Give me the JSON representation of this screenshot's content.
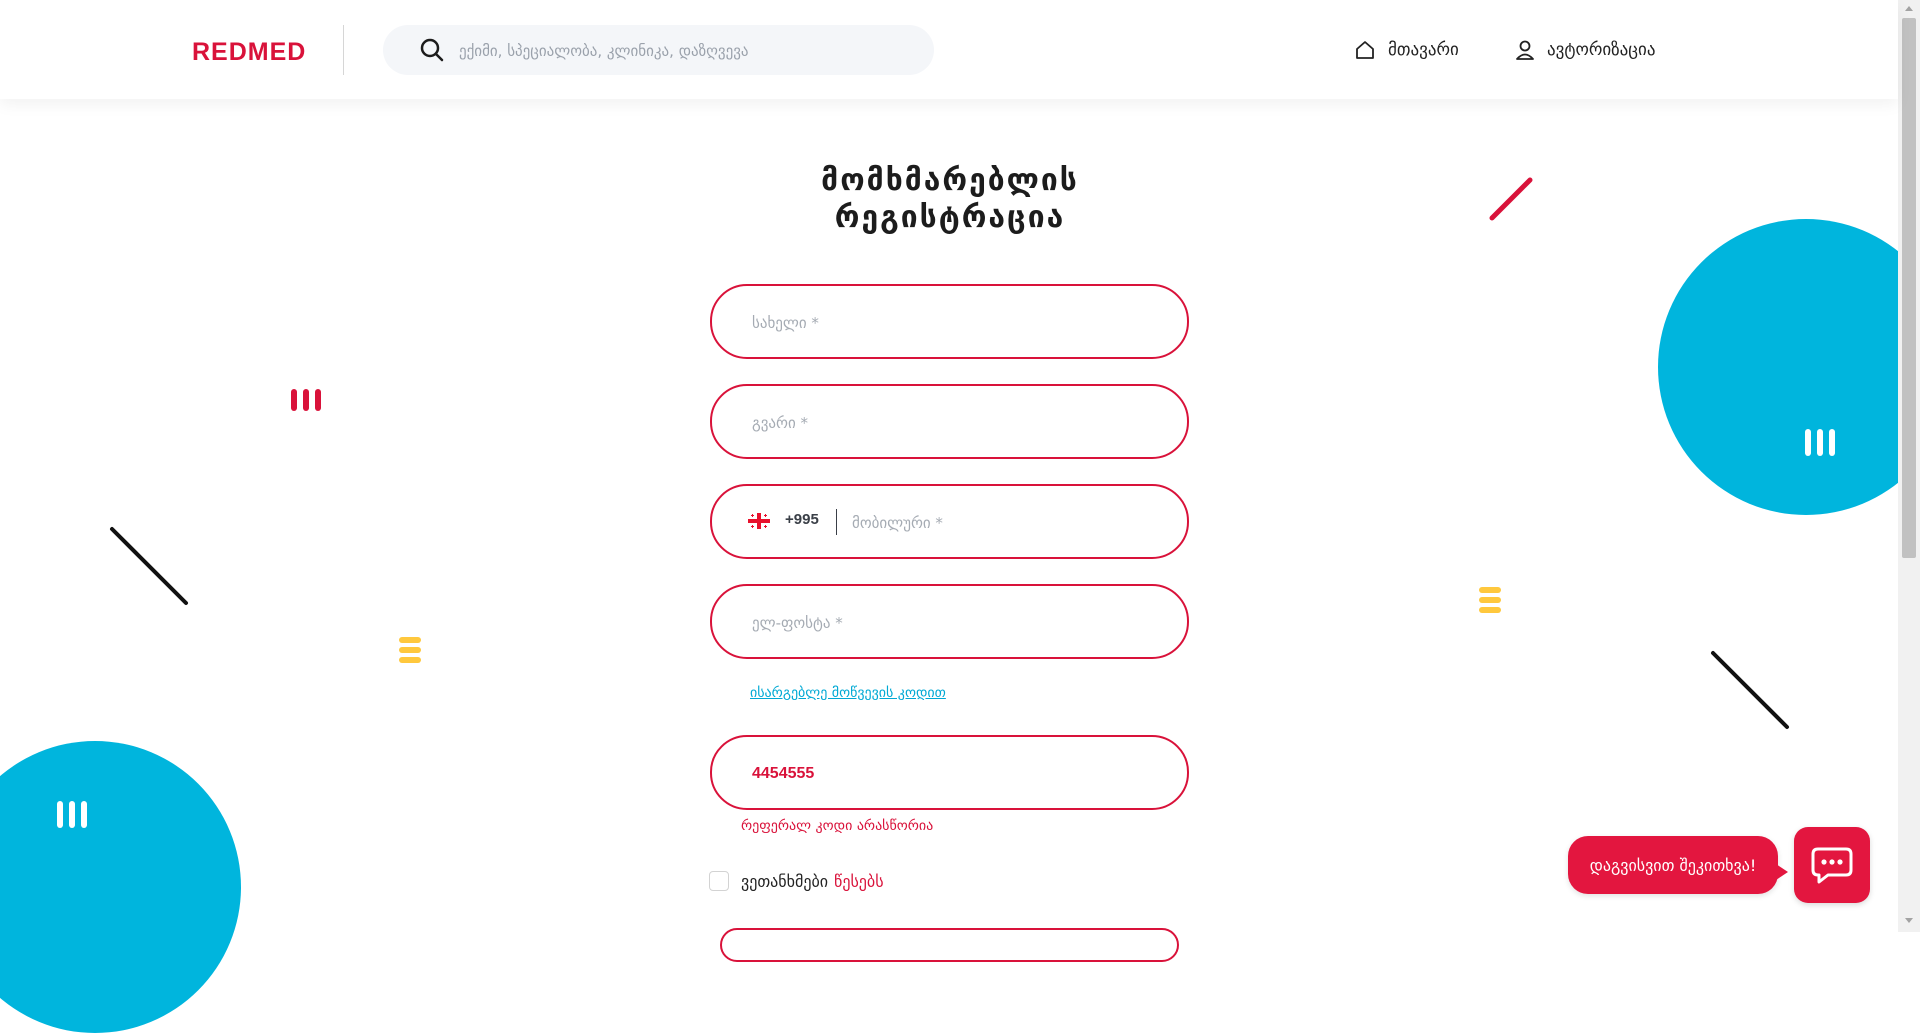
{
  "header": {
    "logo_text": "REDMED",
    "search": {
      "placeholder": "ექიმი, სპეციალობა, კლინიკა, დაზღვევა",
      "icon": "search-icon"
    },
    "nav": [
      {
        "label": "მთავარი",
        "icon": "home-icon"
      },
      {
        "label": "ავტორიზაცია",
        "icon": "user-icon"
      }
    ]
  },
  "form": {
    "title_line1": "მომხმარებლის",
    "title_line2": "რეგისტრაცია",
    "first_name": {
      "placeholder": "სახელი *",
      "value": ""
    },
    "last_name": {
      "placeholder": "გვარი *",
      "value": ""
    },
    "phone": {
      "country_code": "+995",
      "flag_icon": "georgia-flag-icon",
      "placeholder": "მობილური *",
      "value": ""
    },
    "email": {
      "placeholder": "ელ-ფოსტა *",
      "value": ""
    },
    "referral_link_label": "ისარგებლე მოწვევის კოდით",
    "referral": {
      "value": "4454555",
      "error": "რეფერალ კოდი არასწორია"
    },
    "agree": {
      "label": "ვეთანხმები",
      "link": "წესებს",
      "checked": false
    }
  },
  "chat": {
    "bubble_text": "დაგვისვით შეკითხვა!",
    "icon": "chat-icon"
  },
  "colors": {
    "brand_red": "#d9123a",
    "accent_blue": "#00b5dd",
    "accent_yellow": "#ffc83d"
  }
}
